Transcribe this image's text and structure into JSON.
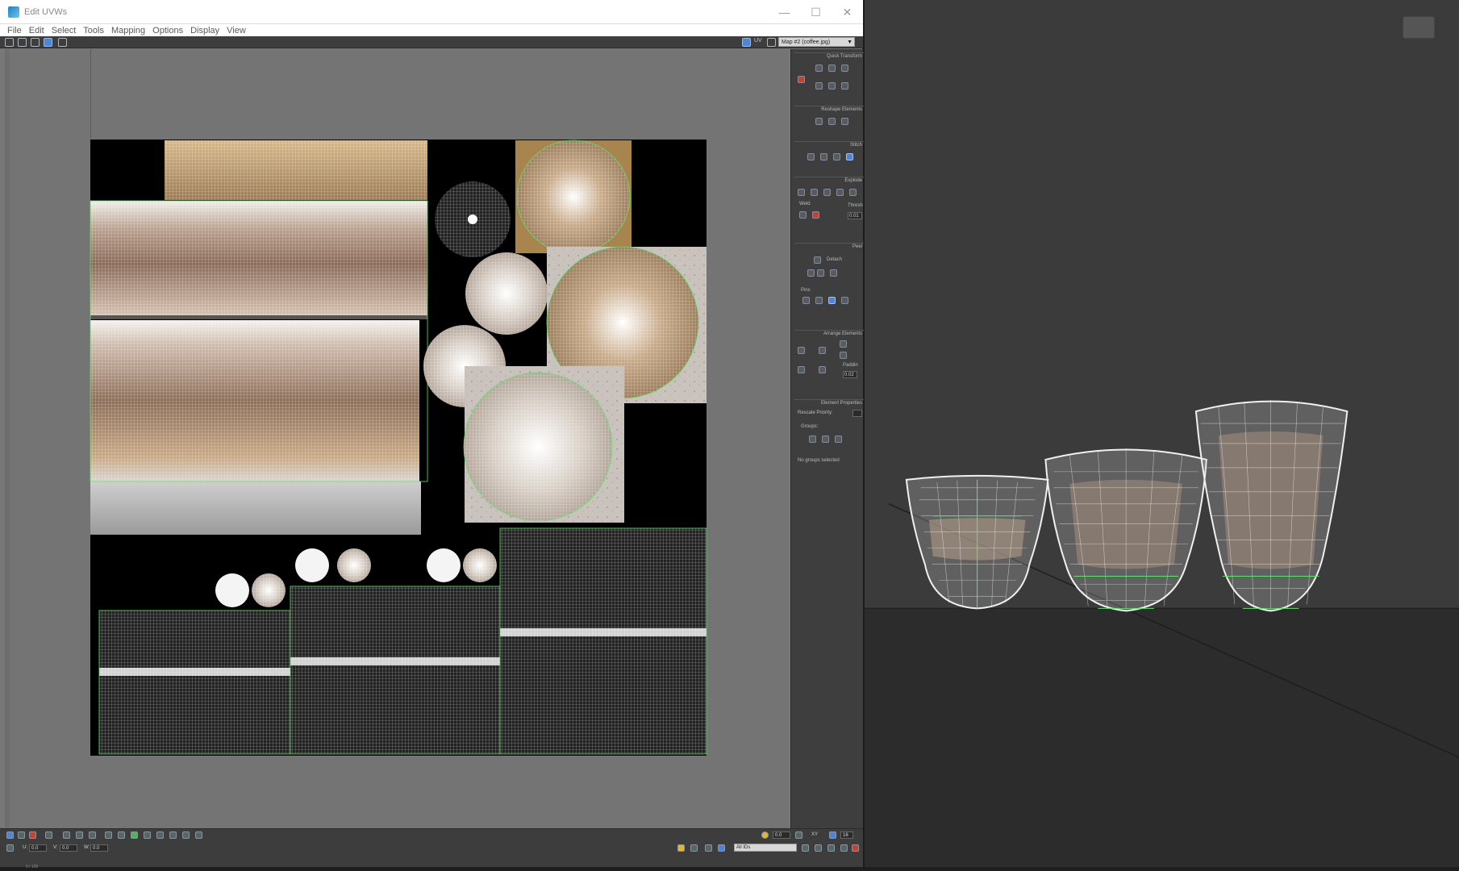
{
  "window": {
    "title": "Edit UVWs",
    "controls": [
      "—",
      "☐",
      "✕"
    ]
  },
  "menu": [
    "File",
    "Edit",
    "Select",
    "Tools",
    "Mapping",
    "Options",
    "Display",
    "View"
  ],
  "toolbar": {
    "uv_label": "UV",
    "map_selector": "Map #2 (coffee.jpg)"
  },
  "panel": {
    "quick_transform": "Quick Transform",
    "reshape_elements": "Reshape Elements",
    "stitch": "Stitch",
    "explode": "Explode",
    "weld": "Weld",
    "threshold_label": "Thresh",
    "threshold_value": "0.01",
    "peel": "Peel",
    "detach": "Detach",
    "pins": "Pins",
    "arrange_elements": "Arrange Elements",
    "padding_label": "Paddin",
    "padding_value": "0.02",
    "element_properties": "Element Properties",
    "rescale_priority": "Rescale Priority:",
    "groups": "Groups:",
    "no_groups": "No groups selected"
  },
  "bottom": {
    "u_label": "U:",
    "u_value": "0.0",
    "v_label": "V:",
    "v_value": "0.0",
    "w_label": "W:",
    "w_value": "0.0",
    "xy_label": "XY",
    "angle_value": "0.0",
    "grid_value": "16",
    "id_filter": "All IDs"
  },
  "status": {
    "progress_text": "0 / 100"
  },
  "colors": {
    "accent": "#4d86d6",
    "uv_edge": "#5fe36a",
    "mesh_line": "#ffffff"
  }
}
